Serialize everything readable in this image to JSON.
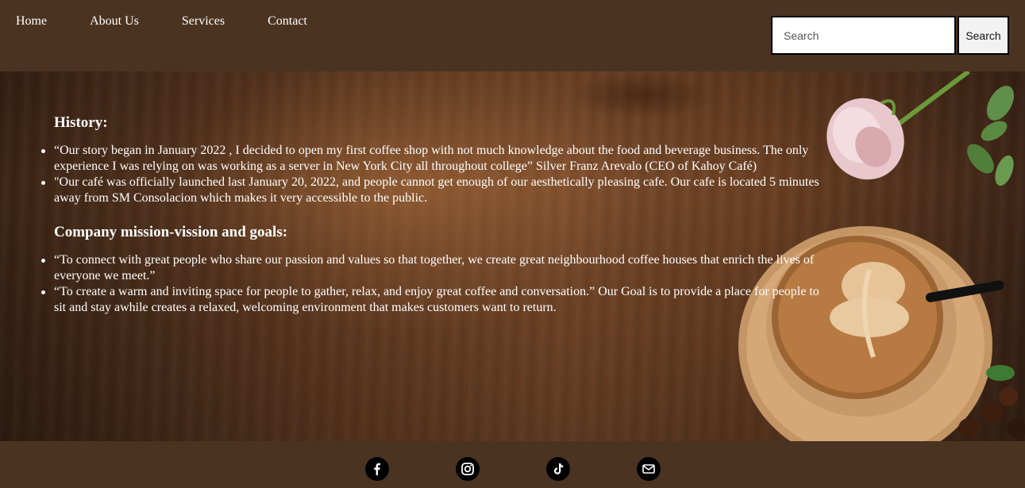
{
  "nav": {
    "items": [
      {
        "label": "Home"
      },
      {
        "label": "About Us"
      },
      {
        "label": "Services"
      },
      {
        "label": "Contact"
      }
    ]
  },
  "search": {
    "placeholder": "Search",
    "button_label": "Search"
  },
  "history": {
    "heading": "History:",
    "items": [
      "“Our story began in January 2022 , I decided to open my first coffee shop with not much knowledge about the food and beverage business. The only experience I was relying on was working as a server in New York City all throughout college” Silver Franz Arevalo (CEO of Kahoy Café)",
      "\"Our café was officially launched last January 20, 2022, and people cannot get enough of our aesthetically pleasing cafe. Our cafe is located 5 minutes away from SM Consolacion which makes it very accessible to the public."
    ]
  },
  "mission": {
    "heading": "Company mission-vission and goals:",
    "items": [
      "“To connect with great people who share our passion and values so that together, we create great neighbourhood coffee houses that enrich the lives of everyone we meet.”",
      "“To create a warm and inviting space for people to gather, relax, and enjoy great coffee and conversation.” Our Goal is to provide a place for people to sit and stay awhile creates a relaxed, welcoming environment that makes customers want to return."
    ]
  },
  "footer": {
    "social": [
      {
        "icon": "facebook-icon"
      },
      {
        "icon": "instagram-icon"
      },
      {
        "icon": "tiktok-icon"
      },
      {
        "icon": "mail-icon"
      }
    ]
  }
}
